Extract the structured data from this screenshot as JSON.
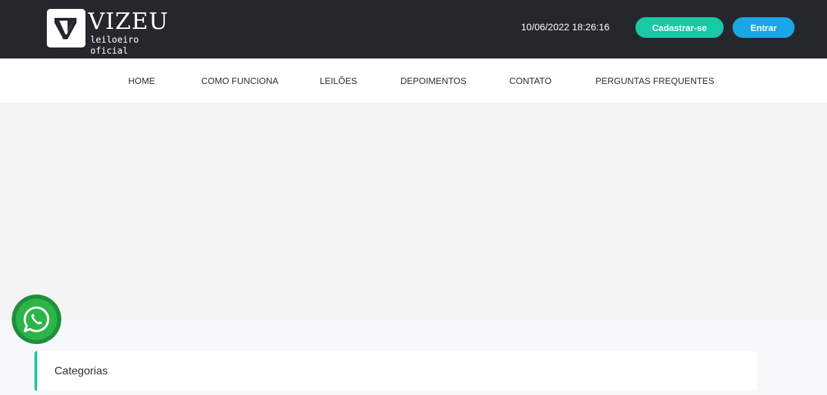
{
  "header": {
    "logo": {
      "name": "VIZEU",
      "subtitle": "leiloeiro oficial"
    },
    "datetime": "10/06/2022 18:26:16",
    "signup_label": "Cadastrar-se",
    "login_label": "Entrar"
  },
  "nav": {
    "items": [
      {
        "label": "HOME"
      },
      {
        "label": "COMO FUNCIONA"
      },
      {
        "label": "LEILÕES"
      },
      {
        "label": "DEPOIMENTOS"
      },
      {
        "label": "CONTATO"
      },
      {
        "label": "PERGUNTAS FREQUENTES"
      }
    ]
  },
  "categories": {
    "title": "Categorias"
  },
  "floating": {
    "icon": "whatsapp-icon"
  },
  "colors": {
    "header_bg": "#24282c",
    "signup_bg": "#19c9a3",
    "login_bg": "#1aa6e6",
    "accent": "#19c9a3",
    "whatsapp": "#2bb548"
  }
}
